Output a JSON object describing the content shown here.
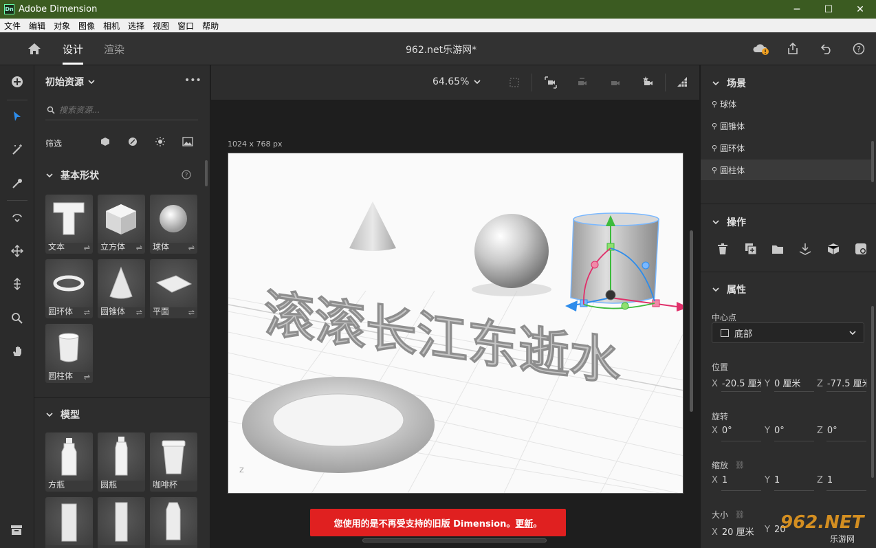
{
  "window": {
    "title": "Adobe Dimension",
    "logo": "Dn"
  },
  "menu": [
    "文件",
    "编辑",
    "对象",
    "图像",
    "相机",
    "选择",
    "视图",
    "窗口",
    "帮助"
  ],
  "topbar": {
    "tab_design": "设计",
    "tab_render": "渲染",
    "doc_title": "962.net乐游网*"
  },
  "assets": {
    "title": "初始资源",
    "search_placeholder": "搜索资源...",
    "filter_label": "筛选",
    "basic_title": "基本形状",
    "basic": [
      "文本",
      "立方体",
      "球体",
      "圆环体",
      "圆锥体",
      "平面",
      "圆柱体"
    ],
    "models_title": "模型",
    "models": [
      "方瓶",
      "圆瓶",
      "咖啡杯"
    ]
  },
  "viewport": {
    "zoom": "64.65%",
    "size_label": "1024 x 768 px",
    "banner_text": "您使用的是不再受支持的旧版 Dimension。",
    "banner_link": "更新",
    "banner_end": "。",
    "canvas_text": "滚滚长江东逝水",
    "axis_z": "Z"
  },
  "scene": {
    "title": "场景",
    "items": [
      "球体",
      "圆锥体",
      "圆环体",
      "圆柱体"
    ],
    "selected": "圆柱体"
  },
  "actions": {
    "title": "操作"
  },
  "properties": {
    "title": "属性",
    "pivot_label": "中心点",
    "pivot_value": "底部",
    "position_label": "位置",
    "position": {
      "x": "-20.5 厘米",
      "y": "0 厘米",
      "z": "-77.5 厘米"
    },
    "rotation_label": "旋转",
    "rotation": {
      "x": "0°",
      "y": "0°",
      "z": "0°"
    },
    "scale_label": "缩放",
    "scale": {
      "x": "1",
      "y": "1",
      "z": "1"
    },
    "size_label": "大小",
    "size": {
      "x": "20 厘米",
      "y": "20"
    }
  },
  "watermark": {
    "text": "962.NET",
    "sub": "乐游网"
  },
  "colors": {
    "titlebar": "#3b5b21",
    "accent": "#2d8ceb",
    "banner": "#e02020",
    "gizmo_y": "#3dbb3d",
    "gizmo_x": "#e0306a",
    "gizmo_z": "#2d8ceb"
  }
}
